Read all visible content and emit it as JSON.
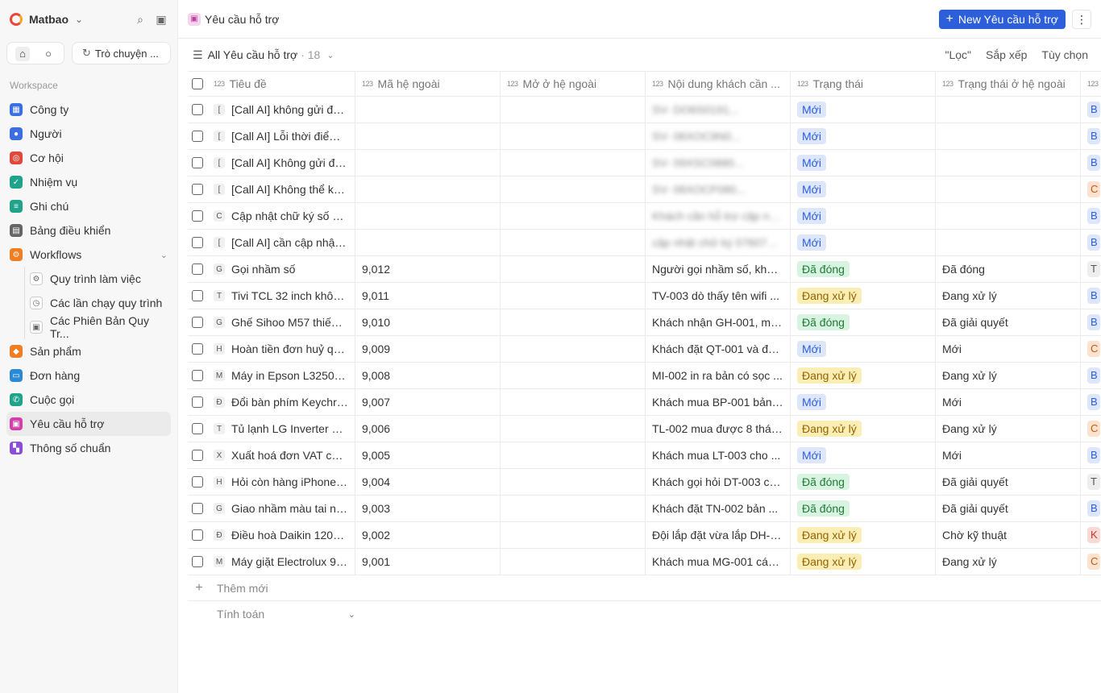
{
  "workspace": {
    "name": "Matbao"
  },
  "sidebar": {
    "chat_label": "Trò chuyện ...",
    "section_label": "Workspace",
    "items": [
      {
        "label": "Công ty",
        "icon": "building-icon",
        "color": "#3b6fe0",
        "glyph": "▦"
      },
      {
        "label": "Người",
        "icon": "user-icon",
        "color": "#3b6fe0",
        "glyph": "●"
      },
      {
        "label": "Cơ hội",
        "icon": "target-icon",
        "color": "#e0483b",
        "glyph": "◎"
      },
      {
        "label": "Nhiệm vụ",
        "icon": "checkbox-icon",
        "color": "#1fa38a",
        "glyph": "✓"
      },
      {
        "label": "Ghi chú",
        "icon": "note-icon",
        "color": "#1fa38a",
        "glyph": "≡"
      },
      {
        "label": "Bảng điều khiển",
        "icon": "dashboard-icon",
        "color": "#666666",
        "glyph": "▤"
      },
      {
        "label": "Workflows",
        "icon": "workflow-icon",
        "color": "#ef7d22",
        "glyph": "⚙"
      }
    ],
    "sub_items": [
      {
        "label": "Quy trình làm việc",
        "icon": "settings-icon",
        "glyph": "⚙"
      },
      {
        "label": "Các lần chạy quy trình",
        "icon": "history-icon",
        "glyph": "◷"
      },
      {
        "label": "Các Phiên Bản Quy Tr...",
        "icon": "versions-icon",
        "glyph": "▣"
      }
    ],
    "items_after": [
      {
        "label": "Sản phẩm",
        "icon": "box-icon",
        "color": "#ef7d22",
        "glyph": "◆"
      },
      {
        "label": "Đơn hàng",
        "icon": "cart-icon",
        "color": "#2b8ad6",
        "glyph": "▭"
      },
      {
        "label": "Cuộc gọi",
        "icon": "phone-icon",
        "color": "#1fa38a",
        "glyph": "✆"
      },
      {
        "label": "Yêu cầu hỗ trợ",
        "icon": "ticket-icon",
        "color": "#d23fa8",
        "glyph": "▣"
      },
      {
        "label": "Thông số chuẩn",
        "icon": "spec-icon",
        "color": "#8a4fd6",
        "glyph": "▚"
      }
    ]
  },
  "header": {
    "title": "Yêu cầu hỗ trợ",
    "new_button": "New Yêu cầu hỗ trợ"
  },
  "view": {
    "name": "All Yêu cầu hỗ trợ",
    "count": "· 18",
    "filter": "\"Lọc\"",
    "sort": "Sắp xếp",
    "options": "Tùy chọn"
  },
  "table": {
    "columns": [
      "Tiêu đề",
      "Mã hệ ngoài",
      "Mở ở hệ ngoài",
      "Nội dung khách cần ...",
      "Trạng thái",
      "Trạng thái ở hệ ngoài",
      ""
    ],
    "rows": [
      {
        "letter": "[",
        "title": "[Call AI] không gửi đượ...",
        "code": "",
        "content": "SV- DO6S0191...",
        "blur": true,
        "status": "Mới",
        "ext": "",
        "tail": "B"
      },
      {
        "letter": "[",
        "title": "[Call AI] Lỗi thời điểm k...",
        "code": "",
        "content": "SV- 06XOC9N0...",
        "blur": true,
        "status": "Mới",
        "ext": "",
        "tail": "B"
      },
      {
        "letter": "[",
        "title": "[Call AI] Không gửi đư...",
        "code": "",
        "content": "SV- 09XSC0880...",
        "blur": true,
        "status": "Mới",
        "ext": "",
        "tail": "B"
      },
      {
        "letter": "[",
        "title": "[Call AI] Không thể ký ...",
        "code": "",
        "content": "SV- 06XOCF080...",
        "blur": true,
        "status": "Mới",
        "ext": "",
        "tail": "C"
      },
      {
        "letter": "C",
        "title": "Cập nhật chữ ký số mớ...",
        "code": "",
        "content": "Khách cần hỗ trợ cập nhật...",
        "blur": true,
        "status": "Mới",
        "ext": "",
        "tail": "B"
      },
      {
        "letter": "[",
        "title": "[Call AI] cần cập nhật c...",
        "code": "",
        "content": "cập nhật chữ ký 07607DE...",
        "blur": true,
        "status": "Mới",
        "ext": "",
        "tail": "B"
      },
      {
        "letter": "G",
        "title": "Gọi nhầm số",
        "code": "9,012",
        "content": "Người gọi nhầm số, khôn...",
        "blur": false,
        "status": "Đã đóng",
        "ext": "Đã đóng",
        "tail": "T"
      },
      {
        "letter": "T",
        "title": "Tivi TCL 32 inch không...",
        "code": "9,011",
        "content": "TV-003 dò thấy tên wifi ...",
        "blur": false,
        "status": "Đang xử lý",
        "ext": "Đang xử lý",
        "tail": "B"
      },
      {
        "letter": "G",
        "title": "Ghế Sihoo M57 thiếu ố...",
        "code": "9,010",
        "content": "Khách nhận GH-001, mở ...",
        "blur": false,
        "status": "Đã đóng",
        "ext": "Đã giải quyết",
        "tail": "B"
      },
      {
        "letter": "H",
        "title": "Hoàn tiền đơn huỷ quạ...",
        "code": "9,009",
        "content": "Khách đặt QT-001 và đã ...",
        "blur": false,
        "status": "Mới",
        "ext": "Mới",
        "tail": "C"
      },
      {
        "letter": "M",
        "title": "Máy in Epson L3250 in...",
        "code": "9,008",
        "content": "MI-002 in ra bản có sọc ...",
        "blur": false,
        "status": "Đang xử lý",
        "ext": "Đang xử lý",
        "tail": "B"
      },
      {
        "letter": "Đ",
        "title": "Đổi bàn phím Keychro...",
        "code": "9,007",
        "content": "Khách mua BP-001 bản tr...",
        "blur": false,
        "status": "Mới",
        "ext": "Mới",
        "tail": "B"
      },
      {
        "letter": "T",
        "title": "Tủ lạnh LG Inverter 26...",
        "code": "9,006",
        "content": "TL-002 mua được 8 tháng...",
        "blur": false,
        "status": "Đang xử lý",
        "ext": "Đang xử lý",
        "tail": "C"
      },
      {
        "letter": "X",
        "title": "Xuất hoá đơn VAT cho ...",
        "code": "9,005",
        "content": "Khách mua LT-003 cho ...",
        "blur": false,
        "status": "Mới",
        "ext": "Mới",
        "tail": "B"
      },
      {
        "letter": "H",
        "title": "Hỏi còn hàng iPhone 1...",
        "code": "9,004",
        "content": "Khách gọi hỏi DT-003 cò...",
        "blur": false,
        "status": "Đã đóng",
        "ext": "Đã giải quyết",
        "tail": "T"
      },
      {
        "letter": "G",
        "title": "Giao nhầm màu tai ngh...",
        "code": "9,003",
        "content": "Khách đặt TN-002 bản ...",
        "blur": false,
        "status": "Đã đóng",
        "ext": "Đã giải quyết",
        "tail": "B"
      },
      {
        "letter": "Đ",
        "title": "Điều hoà Daikin 12000...",
        "code": "9,002",
        "content": "Đội lắp đặt vừa lắp DH-00...",
        "blur": false,
        "status": "Đang xử lý",
        "ext": "Chờ kỹ thuật",
        "tail": "K"
      },
      {
        "letter": "M",
        "title": "Máy giặt Electrolux 9k...",
        "code": "9,001",
        "content": "Khách mua MG-001 cách ...",
        "blur": false,
        "status": "Đang xử lý",
        "ext": "Đang xử lý",
        "tail": "C"
      }
    ],
    "add_label": "Thêm mới",
    "calc_label": "Tính toán"
  },
  "colors": {
    "accent": "#2c5fd9"
  }
}
